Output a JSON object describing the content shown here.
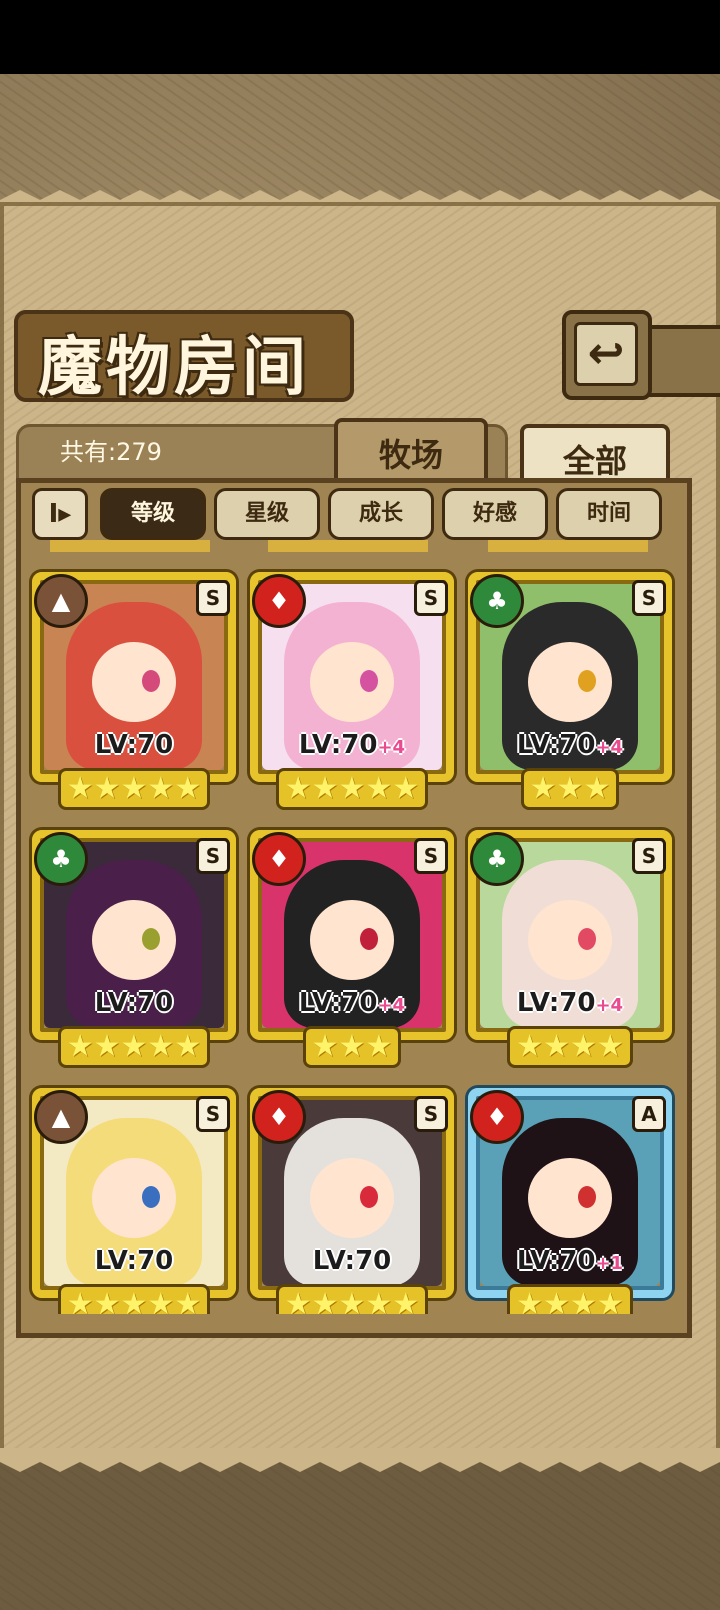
{
  "screen": {
    "title": "魔物房间",
    "back_icon": "back-arrow-icon",
    "count_label": "共有:279",
    "tabs": [
      {
        "label": "牧场",
        "active": false
      },
      {
        "label": "全部",
        "active": true
      }
    ],
    "sort_toggle_label": "I▸",
    "sort_buttons": [
      {
        "label": "等级",
        "active": true
      },
      {
        "label": "星级",
        "active": false
      },
      {
        "label": "成长",
        "active": false
      },
      {
        "label": "好感",
        "active": false
      },
      {
        "label": "时间",
        "active": false
      }
    ]
  },
  "cards": [
    {
      "element": "earth",
      "rank": "S",
      "level": "LV:70",
      "plus": "",
      "stars": "★★★★★",
      "frame": "gold",
      "colors": {
        "hair": "#d9503e",
        "bg": "#c98454",
        "eye": "#d44a7a"
      }
    },
    {
      "element": "fire",
      "rank": "S",
      "level": "LV:70",
      "plus": "+4",
      "stars": "★★★★★",
      "frame": "gold",
      "colors": {
        "hair": "#f4b2d2",
        "bg": "#f6e0ef",
        "eye": "#d452a0"
      }
    },
    {
      "element": "leaf",
      "rank": "S",
      "level": "LV:70",
      "plus": "+4",
      "stars": "★★★",
      "frame": "gold",
      "colors": {
        "hair": "#2a2a2a",
        "bg": "#8fbf6a",
        "eye": "#e0a020"
      }
    },
    {
      "element": "leaf",
      "rank": "S",
      "level": "LV:70",
      "plus": "",
      "stars": "★★★★★",
      "frame": "gold",
      "colors": {
        "hair": "#4a1f4a",
        "bg": "#3a2a3a",
        "eye": "#9aa030"
      }
    },
    {
      "element": "fire",
      "rank": "S",
      "level": "LV:70",
      "plus": "+4",
      "stars": "★★★",
      "frame": "gold",
      "colors": {
        "hair": "#222222",
        "bg": "#d8336a",
        "eye": "#c0203a"
      }
    },
    {
      "element": "leaf",
      "rank": "S",
      "level": "LV:70",
      "plus": "+4",
      "stars": "★★★★",
      "frame": "gold",
      "colors": {
        "hair": "#f0ded6",
        "bg": "#b9d89c",
        "eye": "#e24a64"
      }
    },
    {
      "element": "earth",
      "rank": "S",
      "level": "LV:70",
      "plus": "",
      "stars": "★★★★★",
      "frame": "gold",
      "colors": {
        "hair": "#f5dc7a",
        "bg": "#f3eac4",
        "eye": "#3a6fc0"
      }
    },
    {
      "element": "fire",
      "rank": "S",
      "level": "LV:70",
      "plus": "",
      "stars": "★★★★★",
      "frame": "gold",
      "colors": {
        "hair": "#e4e0dc",
        "bg": "#4a3a3a",
        "eye": "#d82a3a"
      }
    },
    {
      "element": "fire",
      "rank": "A",
      "level": "LV:70",
      "plus": "+1",
      "stars": "★★★★",
      "frame": "blue",
      "colors": {
        "hair": "#1e1216",
        "bg": "#5aa0b6",
        "eye": "#d03030"
      }
    }
  ]
}
